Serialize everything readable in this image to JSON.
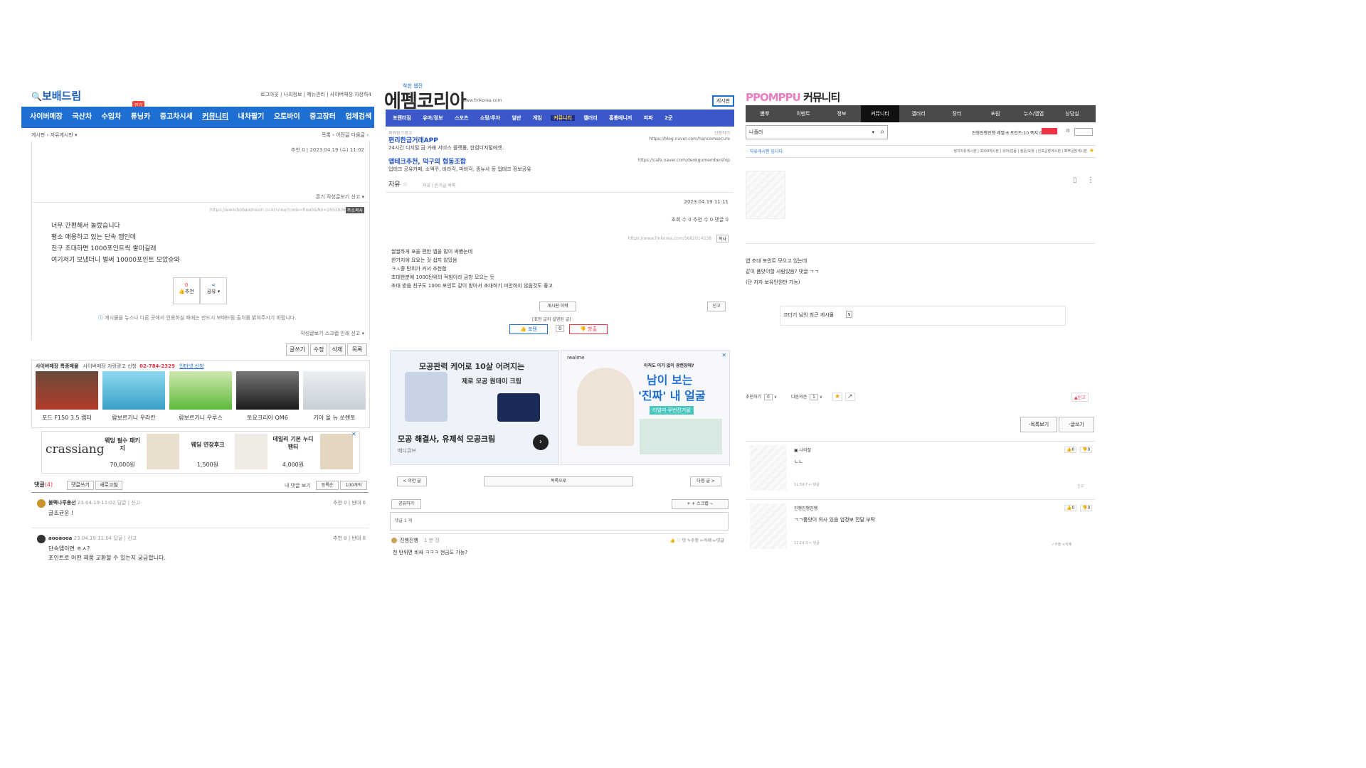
{
  "bobae": {
    "logo": "보배드림",
    "top_links": [
      "로그아웃",
      "나의정보",
      "메뉴관리",
      "사이버매장 자장하4"
    ],
    "badge": "인기",
    "nav": [
      "사이버매장",
      "국산차",
      "수입차",
      "튜닝카",
      "중고차시세",
      "커뮤니티",
      "내차팔기",
      "오토바이",
      "중고장터",
      "업체검색"
    ],
    "crumbs": [
      "게시판",
      "자유게시판 ▾"
    ],
    "crumb_right": "목록  ‹ 이전글  다음글 ›",
    "post_meta": "추천 0  |  2023.04.19 (수) 11:02",
    "tools_top": "폰기  작성글보기  신고 ▾",
    "url": "https://www.bobaedream.co.kr/view?code=freeb&No=2652938",
    "url_btn": "주소복사",
    "body": [
      "너무 간편해서 놀랐습니다",
      "평소 애용하고 있는 단속 앱인데",
      "친구 초대하면 1000포인트씩 쌓이길래",
      "여기저기 보냈더니 벌써 10000포인트 모았슈와"
    ],
    "rec_count": "0",
    "rec_label": "추천",
    "share_label": "공유 ▾",
    "notice": "게시물을 뉴스나 다른 곳에서 인용하실 때에는 반드시 보배드림 출처를 밝혀주시기 바랍니다.",
    "tools_bottom": "작성글보기  스크랩  인쇄  신고 ▾",
    "buttons": [
      "글쓰기",
      "수정",
      "삭제",
      "목록"
    ],
    "shop_title": "사이버매장 특종매물",
    "shop_sub": "사이버매장 자랑광고 신청",
    "shop_phone": "02-784-2329",
    "shop_link": "인터넷 신청",
    "cars": [
      "포드 F150 3.5 랩터",
      "람보르기니 우라칸",
      "람보르기니 우루스",
      "토요크리아 QM6",
      "기아 올 뉴 쏘렌토"
    ],
    "ad_brand": "crassiang",
    "ad_items": [
      {
        "name": "웨딩 필수 패키지",
        "price": "70,000원"
      },
      {
        "name": "웨딩 연장후크",
        "price": "1,500원"
      },
      {
        "name": "데일리 기본 누디팬티",
        "price": "4,000원"
      }
    ],
    "comment_title": "댓글",
    "comment_count": "(4)",
    "comment_btns": [
      "댓글쓰기",
      "새로고침"
    ],
    "comment_right": "내 댓글 보기",
    "comment_sel1": "등록순",
    "comment_sel2": "100개씩",
    "comments": [
      {
        "author": "블랙나루총선",
        "meta": "23.04.19 11:02  답글 | 신고",
        "vote": "추천 0 | 반대 0",
        "text": [
          "글초균운 !"
        ]
      },
      {
        "author": "aooaooa",
        "meta": "23.04.19 11:04  답글 | 신고",
        "vote": "추천 0 | 반대 0",
        "text": [
          "단속앱이면 ㅎㅅ?",
          "포인트로 어떤 제품 교환할 수 있는지 궁금합니다."
        ]
      }
    ]
  },
  "fm": {
    "logo_sub": "착한 웹진",
    "logo": "에펨코리아",
    "domain": "www.fmkorea.com",
    "top_btn": "게시판",
    "nav": [
      "포텐터짐",
      "유머/정보",
      "스포츠",
      "쇼핑/투자",
      "일반",
      "게임",
      "커뮤니티",
      "캘러리",
      "홍통매니저",
      "피파",
      "2군"
    ],
    "ad_label": "파워링크광고",
    "ad_reg": "신청하기",
    "ads": [
      {
        "title": "편리한금거래APP",
        "desc": "24시간 디지털 금 거래 서비스 플랫폼, 한컴디지털에셋.",
        "url": "https://blog.naver.com/hancomsecure"
      },
      {
        "title": "앱테크추천, 덕구의 협동조합",
        "desc": "업테크 공유카페, 소액꾸, 비라각, 파바각, 종뉴사 등 업테크 정보공유",
        "url": "https://cafe.naver.com/deokgumembership"
      }
    ],
    "board": "자유",
    "board_tools": "자유  |  인기글 목록",
    "date": "2023.04.19 11:11",
    "stats": "조회 수 0   추천 수 0   댓글 0",
    "url": "https://www.fmkorea.com/5682014238",
    "url_btn": "복사",
    "body": [
      "쌀쌀하게 포을 편한 앱을 많이 써봤는데",
      "한가지에 요요는 것 쉽지 않았음",
      "ㅋㅅ중 탄위가 커서 추천함",
      "초대한분에 1000탄위의 적힘이라 금방 모으는 듯",
      "초대 받음 친구도 1000 포인트 같이 받아서 초대하기 미안하지 않음것도 좋고"
    ],
    "view_btn": "게시판 이력",
    "report_btn": "신고",
    "vote_hint": "[표현 글지 설명된 글]",
    "vote_up": "포텐",
    "vote_mid": "0",
    "vote_down": "방출",
    "banner1": {
      "line1": "모공판력 케어로 10살 어려지는",
      "line2": "제로 모공 원데이 크림",
      "headline": "모공 해결사, 유제석 모공크림",
      "brand": "메디큐브"
    },
    "banner2": {
      "brand": "realme",
      "top": "아직도 이거 없이 광캔장에?",
      "line1": "남이 보는",
      "line2": "'진짜' 내 얼굴",
      "cta": "리얼미 무번진거울"
    },
    "prev": "< 이전 글",
    "list": "목록으로",
    "next": "다음 글 >",
    "share_btn": "공유하기",
    "share_right": "+  +  스크랩  −",
    "cmt_label": "댓글 1 개",
    "cmt_author": "진행진행",
    "cmt_time": "1 분 전",
    "cmt_tools": "👍  ♡  댓  ✎수정  ✂삭제  ↩댓글",
    "cmt_text": "천 탄위면 비싸 ㅋㅋㅋ 현금도 가능?"
  },
  "ppomppu": {
    "logo": "PPOMPPU",
    "title": "커뮤니티",
    "nav": [
      "뽐뿌",
      "이벤트",
      "정보",
      "커뮤니티",
      "갤러리",
      "장터",
      "포럼",
      "뉴스/앱앱",
      "상담실"
    ],
    "search_value": "나플러",
    "user_info": "진형진행진행 레벨:6  포인트:10  쪽지:0",
    "notice": "· 자유게시판 입니다.",
    "right_links": "정치자유게시판 | 1000게시판 | 유머/감동 | 질문/요청 | 인포공방게시판 | 뽀뿌공방게시판",
    "body": [
      "앱 초대 포인트 모으고 있는데",
      "같이 품앗이할 사람있음? 댓글 ㄱㄱ",
      "(단 자자 보유인원만 가능)"
    ],
    "recent": "코더기 님의 최근 게시물",
    "rec_label": "추천하기",
    "rec_count": "0",
    "opp_label": "다른의견",
    "opp_count": "1",
    "report": "신고",
    "list_btn": "-목록보기",
    "write_btn": "-글쓰기",
    "comments": [
      {
        "author": "나라잘",
        "text": "ㄴㄴ",
        "meta": "11:54:7  ↩ 댓글",
        "up": "0",
        "down": "0",
        "right": "신고"
      },
      {
        "author": "진행진행진행",
        "text": "ㄱㄱ품앗이 의사 있음 업정보 전달 부탁",
        "meta": "11:14:3  ↩ 댓글",
        "up": "0",
        "down": "0",
        "right": "✓수정  ✕삭제"
      }
    ]
  }
}
